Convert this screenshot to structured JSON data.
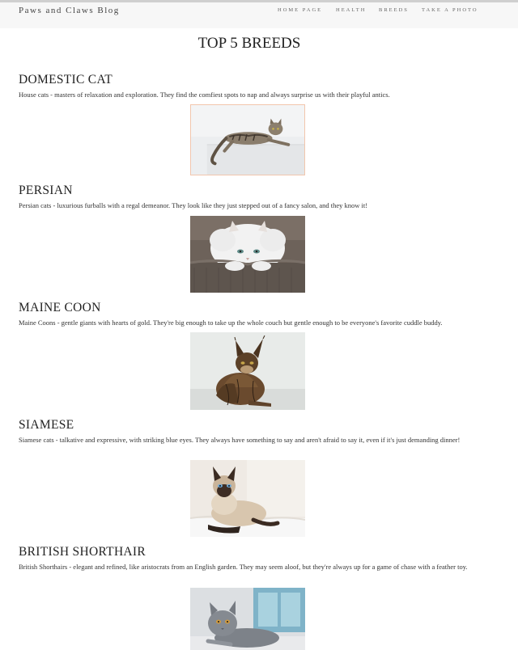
{
  "header": {
    "brand": "Paws and Claws Blog",
    "nav": [
      "HOME PAGE",
      "HEALTH",
      "BREEDS",
      "TAKE A PHOTO"
    ]
  },
  "page_title": "TOP 5 BREEDS",
  "breeds": [
    {
      "name": "DOMESTIC CAT",
      "description": "House cats - masters of relaxation and exploration. They find the comfiest spots to nap and always surprise us with their playful antics."
    },
    {
      "name": "PERSIAN",
      "description": "Persian cats - luxurious furballs with a regal demeanor. They look like they just stepped out of a fancy salon, and they know it!"
    },
    {
      "name": "MAINE COON",
      "description": "Maine Coons - gentle giants with hearts of gold. They're big enough to take up the whole couch but gentle enough to be everyone's favorite cuddle buddy."
    },
    {
      "name": "SIAMESE",
      "description": "Siamese cats - talkative and expressive, with striking blue eyes. They always have something to say and aren't afraid to say it, even if it's just demanding dinner!"
    },
    {
      "name": "BRITISH SHORTHAIR",
      "description": "British Shorthairs - elegant and refined, like aristocrats from an English garden. They may seem aloof, but they're always up for a game of chase with a feather toy."
    }
  ]
}
